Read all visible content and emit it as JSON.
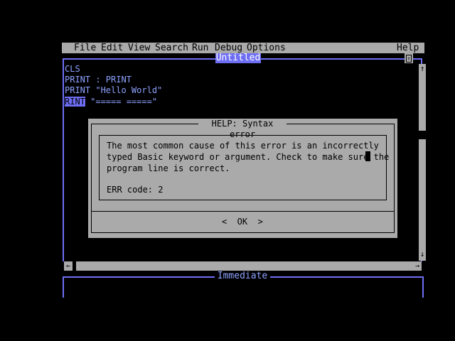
{
  "menubar": {
    "items": [
      "File",
      "Edit",
      "View",
      "Search",
      "Run",
      "Debug",
      "Options"
    ],
    "help": "Help"
  },
  "editor": {
    "title": "Untitled",
    "lines": [
      "CLS",
      "PRINT : PRINT",
      "PRINT \"Hello World\""
    ],
    "last_line_keyword": "RINT",
    "last_line_rest": " \"===== =====\""
  },
  "scrollbars": {
    "up": "↑",
    "down": "↓",
    "left": "←",
    "right": "→",
    "maximize": "↑"
  },
  "immediate": {
    "title": "Immediate"
  },
  "dialog": {
    "title": "HELP: Syntax error",
    "message_lines": [
      "The most common cause of this error is an incorrectly",
      "typed Basic keyword or argument. Check to make sure the",
      "program line is correct."
    ],
    "error_code": "ERR code: 2",
    "ok_label": "<  OK  >"
  },
  "colors": {
    "background": "#000000",
    "accent_blue": "#6e6ef5",
    "code_text": "#8ea2ff",
    "dialog_gray": "#aaaaaa"
  }
}
